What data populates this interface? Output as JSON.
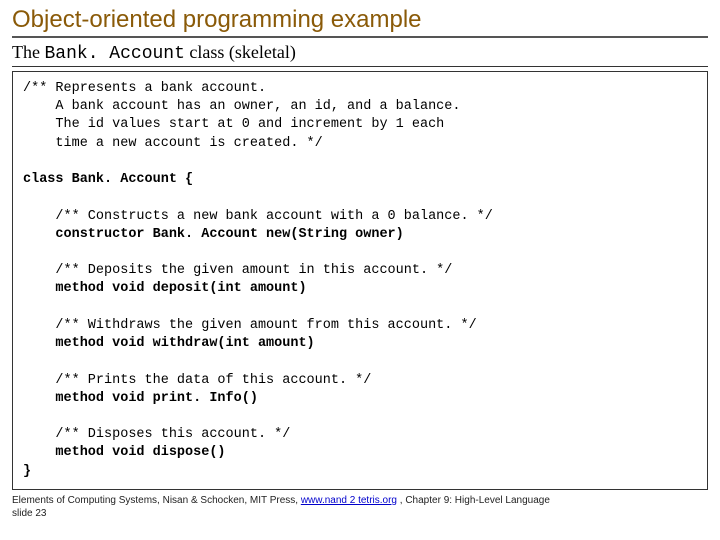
{
  "title": "Object-oriented programming example",
  "subtitle_prefix": "The ",
  "subtitle_mono": "Bank. Account",
  "subtitle_suffix": " class (skeletal)",
  "code": {
    "doc_l1": "/** Represents a bank account.",
    "doc_l2": "    A bank account has an owner, an id, and a balance.",
    "doc_l3": "    The id values start at 0 and increment by 1 each",
    "doc_l4": "    time a new account is created. */",
    "class_decl": "class Bank. Account {",
    "ctor_doc": "    /** Constructs a new bank account with a 0 balance. */",
    "ctor_sig": "    constructor Bank. Account new(String owner)",
    "dep_doc": "    /** Deposits the given amount in this account. */",
    "dep_sig": "    method void deposit(int amount)",
    "wd_doc": "    /** Withdraws the given amount from this account. */",
    "wd_sig": "    method void withdraw(int amount)",
    "pi_doc": "    /** Prints the data of this account. */",
    "pi_sig": "    method void print. Info()",
    "disp_doc": "    /** Disposes this account. */",
    "disp_sig": "    method void dispose()",
    "close": "}"
  },
  "footer": {
    "before_link": "Elements of Computing Systems, Nisan & Schocken, MIT Press, ",
    "link_text": "www.nand 2 tetris.org",
    "after_link": " , Chapter 9: High-Level Language",
    "slide_no": "slide 23"
  }
}
